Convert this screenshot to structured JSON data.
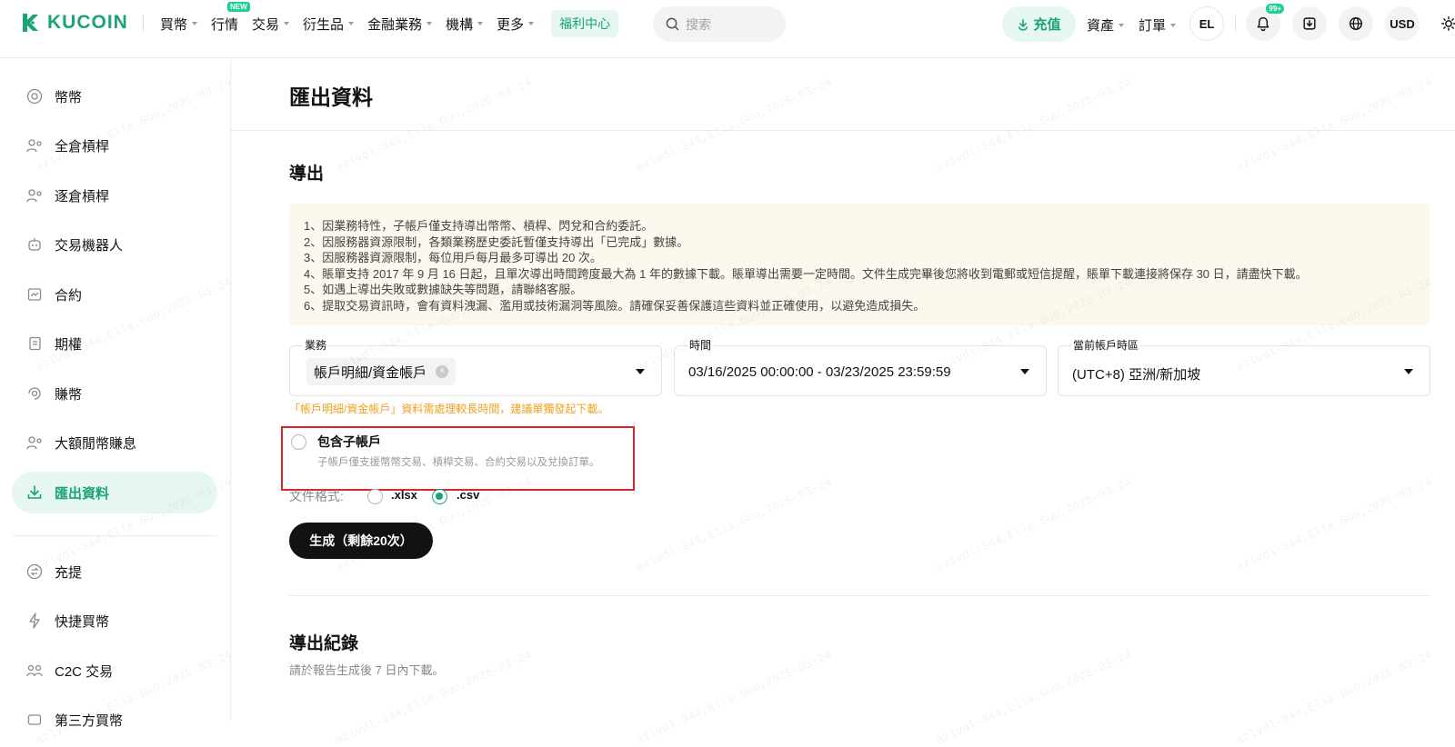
{
  "brand": {
    "name": "KUCOIN",
    "accent": "#1ba27a",
    "accent_bg": "#e6f7f0"
  },
  "nav": {
    "menu": [
      {
        "label": "買幣",
        "caret": true
      },
      {
        "label": "行情",
        "caret": false,
        "badge": "NEW"
      },
      {
        "label": "交易",
        "caret": true
      },
      {
        "label": "衍生品",
        "caret": true
      },
      {
        "label": "金融業務",
        "caret": true
      },
      {
        "label": "機構",
        "caret": true
      },
      {
        "label": "更多",
        "caret": true
      }
    ],
    "welfare": "福利中心",
    "search_placeholder": "搜索",
    "deposit": "充值",
    "assets": "資產",
    "orders": "訂單",
    "avatar": "EL",
    "notif_badge": "99+",
    "currency": "USD"
  },
  "sidebar": {
    "items": [
      {
        "label": "幣幣",
        "icon": "coin-icon"
      },
      {
        "label": "全倉槓桿",
        "icon": "cross-margin-icon"
      },
      {
        "label": "逐倉槓桿",
        "icon": "isolated-margin-icon"
      },
      {
        "label": "交易機器人",
        "icon": "robot-icon"
      },
      {
        "label": "合約",
        "icon": "futures-icon"
      },
      {
        "label": "期權",
        "icon": "options-icon"
      },
      {
        "label": "賺幣",
        "icon": "earn-icon"
      },
      {
        "label": "大額閒幣賺息",
        "icon": "large-earn-icon"
      },
      {
        "label": "匯出資料",
        "icon": "download-icon",
        "active": true
      },
      {
        "label": "充提",
        "icon": "deposit-withdraw-icon"
      },
      {
        "label": "快捷買幣",
        "icon": "lightning-icon"
      },
      {
        "label": "C2C 交易",
        "icon": "c2c-icon"
      },
      {
        "label": "第三方買幣",
        "icon": "third-party-icon"
      }
    ]
  },
  "main": {
    "title": "匯出資料",
    "export_section": "導出",
    "notice": [
      "1、因業務特性，子帳戶僅支持導出幣幣、槓桿、閃兌和合約委託。",
      "2、因服務器資源限制，各類業務歷史委託暫僅支持導出「已完成」數據。",
      "3、因服務器資源限制，每位用戶每月最多可導出 20 次。",
      "4、賬單支持 2017 年 9 月 16 日起，且單次導出時間跨度最大為 1 年的數據下載。賬單導出需要一定時間。文件生成完畢後您將收到電郵或短信提醒，賬單下載連接將保存 30 日，請盡快下載。",
      "5、如遇上導出失敗或數據缺失等問題，請聯絡客服。",
      "6、提取交易資訊時，會有資料洩漏、濫用或技術漏洞等風險。請確保妥善保護這些資料並正確使用，以避免造成損失。"
    ],
    "business": {
      "label": "業務",
      "value": "帳戶明細/資金帳戶"
    },
    "time": {
      "label": "時間",
      "value": "03/16/2025 00:00:00 - 03/23/2025 23:59:59"
    },
    "timezone": {
      "label": "當前帳戶時區",
      "value": "(UTC+8) 亞洲/新加坡"
    },
    "warning": "「帳戶明細/資金帳戶」資料需處理較長時間，建議單獨發起下載。",
    "warning_color": "#f0a020",
    "subaccount": {
      "title": "包含子帳戶",
      "desc": "子帳戶僅支援幣幣交易、槓桿交易、合約交易以及兌換訂單。",
      "checked": false
    },
    "format": {
      "label": "文件格式:",
      "options": [
        ".xlsx",
        ".csv"
      ],
      "selected": ".csv"
    },
    "generate": "生成（剩餘20次）",
    "records_title": "導出紀錄",
    "records_note": "請於報告生成後 7 日內下載。"
  },
  "watermark": "azlvdl-344,Ella.Guo,2025-03-24"
}
